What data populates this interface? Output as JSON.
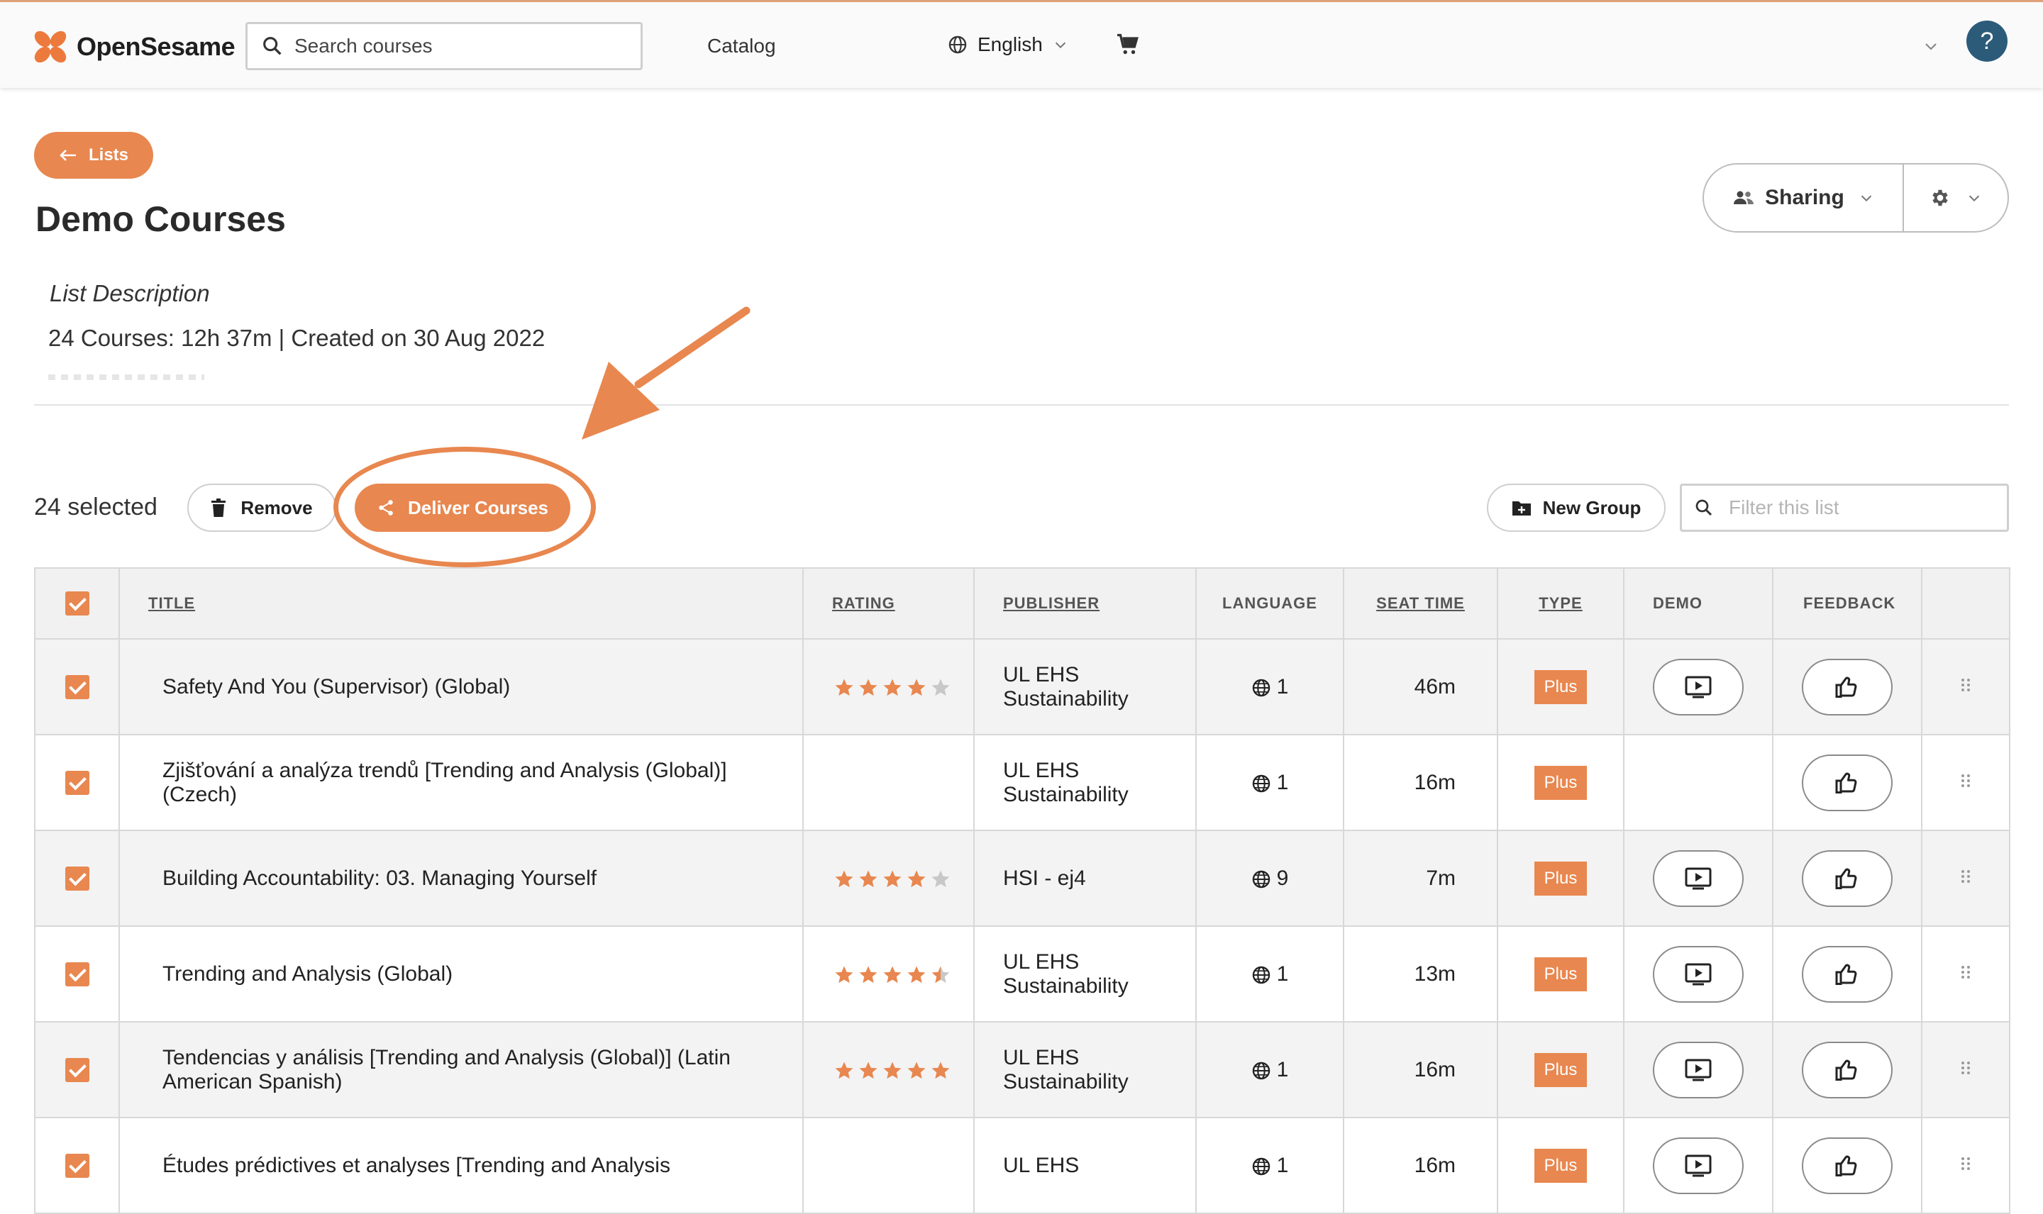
{
  "header": {
    "brand": "OpenSesame",
    "search_placeholder": "Search courses",
    "nav_catalog": "Catalog",
    "language": "English",
    "help": "?"
  },
  "page": {
    "back_label": "Lists",
    "title": "Demo Courses",
    "description": "List Description",
    "meta": "24 Courses: 12h 37m | Created on 30 Aug 2022",
    "sharing_label": "Sharing"
  },
  "toolbar": {
    "selected": "24 selected",
    "remove": "Remove",
    "deliver": "Deliver Courses",
    "new_group": "New Group",
    "filter_placeholder": "Filter this list"
  },
  "table": {
    "columns": [
      "TITLE",
      "RATING",
      "PUBLISHER",
      "LANGUAGE",
      "SEAT TIME",
      "TYPE",
      "DEMO",
      "FEEDBACK"
    ],
    "rows": [
      {
        "title": "Safety And You (Supervisor) (Global)",
        "rating": 4,
        "publisher": [
          "UL EHS",
          "Sustainability"
        ],
        "languages": "1",
        "seat_time": "46m",
        "type": "Plus",
        "demo": true
      },
      {
        "title": "Zjišťování a analýza trendů [Trending and Analysis (Global)] (Czech)",
        "rating": 0,
        "publisher": [
          "UL EHS",
          "Sustainability"
        ],
        "languages": "1",
        "seat_time": "16m",
        "type": "Plus",
        "demo": false
      },
      {
        "title": "Building Accountability: 03. Managing Yourself",
        "rating": 4,
        "publisher": [
          "HSI - ej4"
        ],
        "languages": "9",
        "seat_time": "7m",
        "type": "Plus",
        "demo": true
      },
      {
        "title": "Trending and Analysis (Global)",
        "rating": 4.5,
        "publisher": [
          "UL EHS",
          "Sustainability"
        ],
        "languages": "1",
        "seat_time": "13m",
        "type": "Plus",
        "demo": true
      },
      {
        "title": "Tendencias y análisis [Trending and Analysis (Global)] (Latin American Spanish)",
        "rating": 5,
        "publisher": [
          "UL EHS",
          "Sustainability"
        ],
        "languages": "1",
        "seat_time": "16m",
        "type": "Plus",
        "demo": true
      },
      {
        "title": "Études prédictives et analyses [Trending and Analysis",
        "rating": 0,
        "publisher": [
          "UL EHS"
        ],
        "languages": "1",
        "seat_time": "16m",
        "type": "Plus",
        "demo": true
      }
    ]
  },
  "colors": {
    "accent": "#e8874f",
    "help": "#2c5b7a"
  }
}
